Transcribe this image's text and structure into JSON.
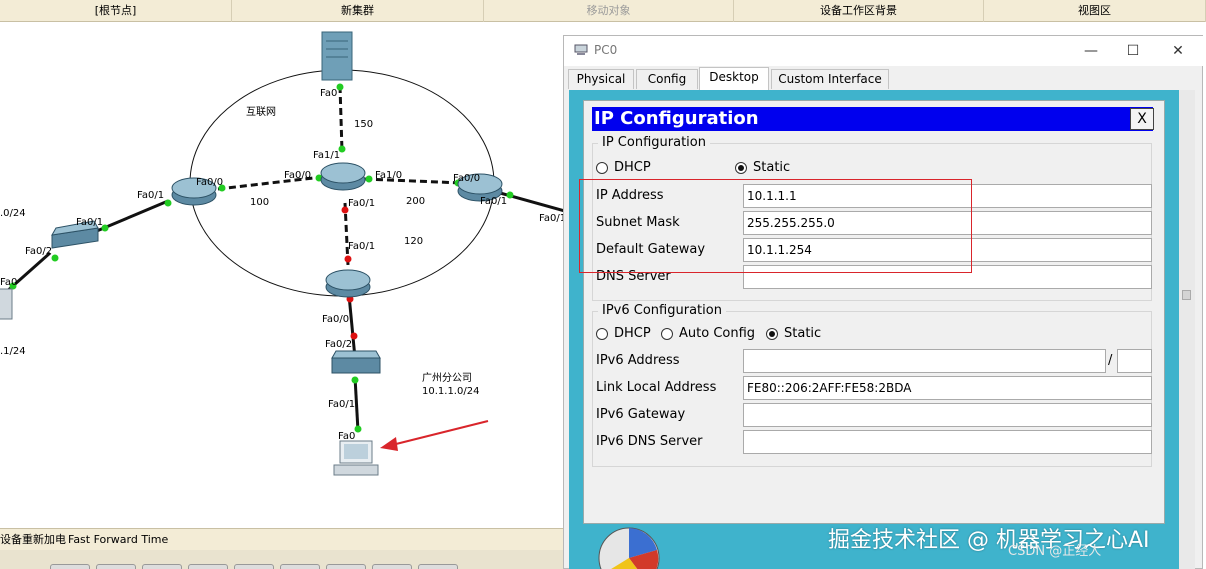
{
  "toolbar": {
    "root": "[根节点]",
    "new_cluster": "新集群",
    "move_object": "移动对象",
    "workspace_bg": "设备工作区背景",
    "viewport": "视图区"
  },
  "topology": {
    "ring_label": "互联网",
    "branch_label": "广州分公司",
    "branch_net": "10.1.1.0/24",
    "left_net_top": ".0/24",
    "left_net_bottom": ".1/24",
    "links": {
      "top": "150",
      "left": "100",
      "right": "200",
      "bottom": "120"
    },
    "ports": {
      "server_fa0": "Fa0",
      "center_fa1_1": "Fa1/1",
      "center_fa0_0": "Fa0/0",
      "center_fa1_0": "Fa1/0",
      "center_fa0_1": "Fa0/1",
      "left_fa0_0": "Fa0/0",
      "left_fa0_1": "Fa0/1",
      "right_fa0_0": "Fa0/0",
      "right_fa0_1": "Fa0/1",
      "right_out": "Fa0/1",
      "bottom_fa0_1": "Fa0/1",
      "bottom_fa0_0": "Fa0/0",
      "sw_fa0_2": "Fa0/2",
      "sw_fa0_1": "Fa0/1",
      "pc_fa0": "Fa0",
      "lsw_fa0_1": "Fa0/1",
      "lsw_fa0_2": "Fa0/2",
      "lpc_fa0": "Fa0"
    }
  },
  "status": {
    "left": "设备重新加电",
    "right": "Fast Forward Time"
  },
  "window": {
    "title": "PC0",
    "tabs": [
      "Physical",
      "Config",
      "Desktop",
      "Custom Interface"
    ],
    "active_tab": "Desktop",
    "minimize": "—",
    "maximize": "☐",
    "close": "✕"
  },
  "ipconfig": {
    "header": "IP Configuration",
    "close": "X",
    "ipv4_group": "IP Configuration",
    "dhcp": "DHCP",
    "static": "Static",
    "mode": "Static",
    "ip_label": "IP Address",
    "ip_value": "10.1.1.1",
    "mask_label": "Subnet Mask",
    "mask_value": "255.255.255.0",
    "gw_label": "Default Gateway",
    "gw_value": "10.1.1.254",
    "dns_label": "DNS Server",
    "dns_value": "",
    "ipv6_group": "IPv6 Configuration",
    "v6_dhcp": "DHCP",
    "v6_auto": "Auto Config",
    "v6_static": "Static",
    "v6_mode": "Static",
    "v6_addr_label": "IPv6 Address",
    "v6_addr_value": "",
    "v6_slash": "/",
    "v6_prefix_value": "",
    "v6_lla_label": "Link Local Address",
    "v6_lla_value": "FE80::206:2AFF:FE58:2BDA",
    "v6_gw_label": "IPv6 Gateway",
    "v6_gw_value": "",
    "v6_dns_label": "IPv6 DNS Server",
    "v6_dns_value": ""
  },
  "watermark": {
    "main": "掘金技术社区 @ 机器学习之心AI",
    "sub": "CSDN @正经人"
  },
  "colors": {
    "link_up": "#22cc22",
    "link_down": "#dd1111",
    "ip_header": "#0000ee",
    "desktop_bg": "#3fb3cc",
    "highlight": "#d9252b"
  }
}
